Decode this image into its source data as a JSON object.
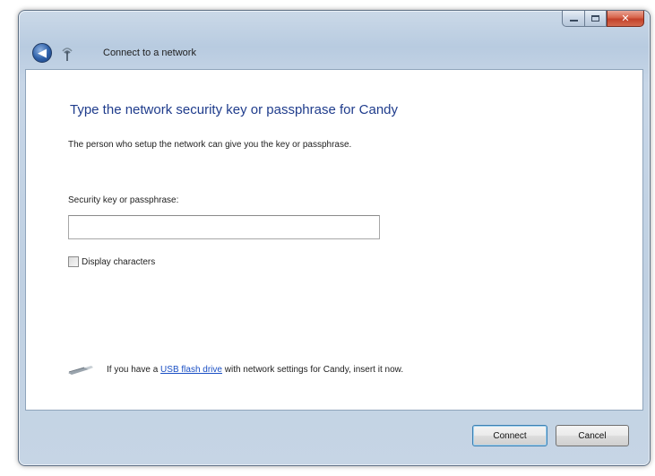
{
  "window": {
    "nav_title": "Connect to a network",
    "caption": {
      "minimize_icon": "minimize-icon",
      "maximize_icon": "maximize-icon",
      "close_icon": "close-icon",
      "close_glyph": "✕"
    }
  },
  "nav": {
    "back_icon": "back-arrow-icon",
    "back_glyph": "◀",
    "network_icon": "wireless-network-icon"
  },
  "main": {
    "heading": "Type the network security key or passphrase for Candy",
    "subtext": "The person who setup the network can give you the key or passphrase.",
    "field_label": "Security key or passphrase:",
    "key_value": "",
    "display_characters_label": "Display characters",
    "display_characters_checked": false,
    "usb_prefix": "If you have a ",
    "usb_link": "USB flash drive",
    "usb_suffix": " with network settings for Candy, insert it now.",
    "usb_icon": "usb-drive-icon"
  },
  "buttons": {
    "connect": "Connect",
    "cancel": "Cancel"
  },
  "colors": {
    "heading": "#1f3c8c",
    "link": "#1a4fc4",
    "close_button": "#c2412a"
  }
}
